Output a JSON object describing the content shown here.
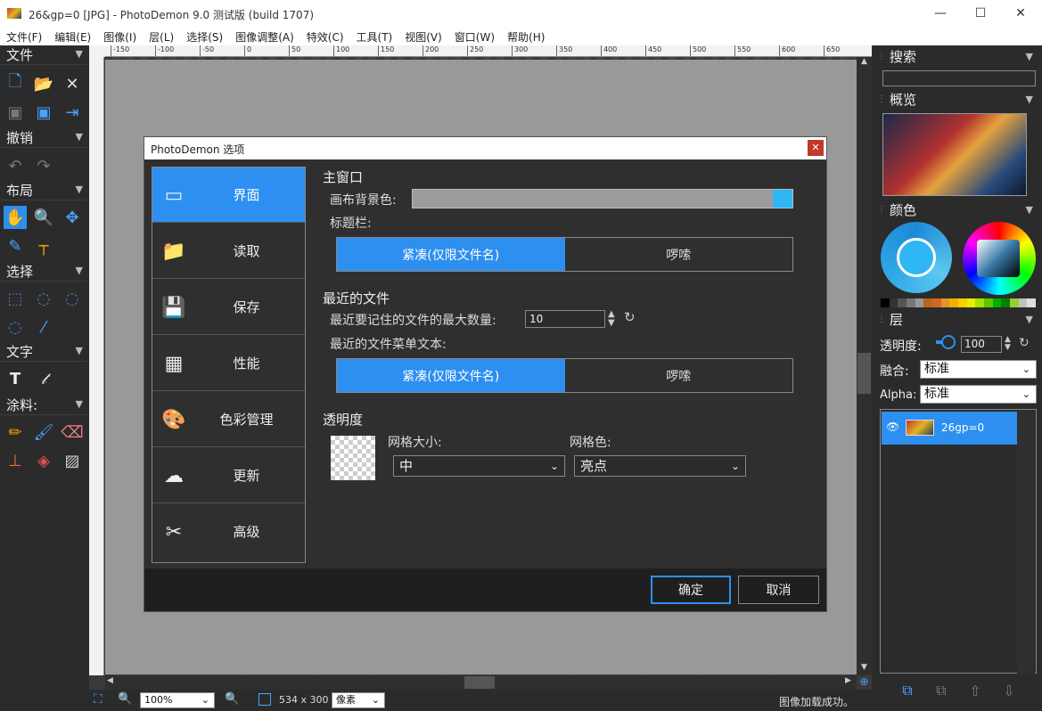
{
  "window": {
    "title": "26&gp=0 [JPG]  -  PhotoDemon 9.0 测试版 (build 1707)"
  },
  "menu": [
    "文件(F)",
    "编辑(E)",
    "图像(I)",
    "层(L)",
    "选择(S)",
    "图像调整(A)",
    "特效(C)",
    "工具(T)",
    "视图(V)",
    "窗口(W)",
    "帮助(H)"
  ],
  "toolbar": {
    "file": "文件",
    "undo": "撤销",
    "layout": "布局",
    "select": "选择",
    "text": "文字",
    "paint": "涂料:"
  },
  "ruler": [
    "-150",
    "-100",
    "-50",
    "0",
    "50",
    "100",
    "150",
    "200",
    "250",
    "300",
    "350",
    "400",
    "450",
    "500",
    "550",
    "600",
    "650"
  ],
  "status": {
    "zoom": "100%",
    "size": "534 x 300",
    "unit": "像素",
    "message": "图像加载成功。"
  },
  "right": {
    "search": "搜索",
    "overview": "概览",
    "color": "颜色",
    "layers": "层",
    "opacity_label": "透明度:",
    "opacity_value": "100",
    "blend_label": "融合:",
    "blend_value": "标准",
    "alpha_label": "Alpha:",
    "alpha_value": "标准",
    "layer_name": "26gp=0",
    "accent": "#2d8ff0",
    "palette": [
      "#000000",
      "#333333",
      "#555555",
      "#777777",
      "#999999",
      "#b5651d",
      "#d2691e",
      "#e6912f",
      "#f0b000",
      "#f7d000",
      "#e8f000",
      "#a8e000",
      "#5cc800",
      "#00b000",
      "#008000",
      "#9acd32",
      "#c0c0c0",
      "#dddddd"
    ]
  },
  "dialog": {
    "title": "PhotoDemon 选项",
    "categories": [
      {
        "label": "界面",
        "icon": "window-icon"
      },
      {
        "label": "读取",
        "icon": "folder-icon"
      },
      {
        "label": "保存",
        "icon": "save-icon"
      },
      {
        "label": "性能",
        "icon": "cpu-icon"
      },
      {
        "label": "色彩管理",
        "icon": "palette-icon"
      },
      {
        "label": "更新",
        "icon": "cloud-download-icon"
      },
      {
        "label": "高级",
        "icon": "tools-icon"
      }
    ],
    "main_window": "主窗口",
    "bg_color_label": "画布背景色:",
    "bg_color": "#9b9b9b",
    "swatch_color": "#2fb6f5",
    "titlebar_label": "标题栏:",
    "titlebar_opt1": "紧凑(仅限文件名)",
    "titlebar_opt2": "啰嗦",
    "recent_title": "最近的文件",
    "recent_max_label": "最近要记住的文件的最大数量:",
    "recent_max_value": "10",
    "recent_menu_label": "最近的文件菜单文本:",
    "recent_opt1": "紧凑(仅限文件名)",
    "recent_opt2": "啰嗦",
    "transparency_title": "透明度",
    "grid_size_label": "网格大小:",
    "grid_size_value": "中",
    "grid_color_label": "网格色:",
    "grid_color_value": "亮点",
    "ok": "确定",
    "cancel": "取消"
  }
}
